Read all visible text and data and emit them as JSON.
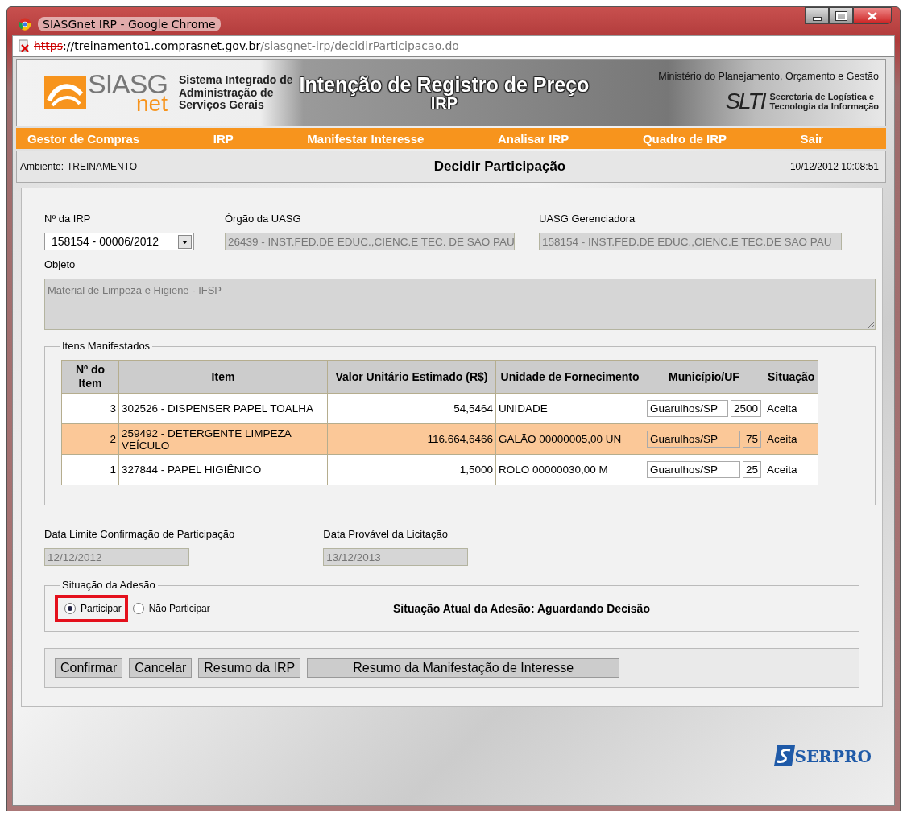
{
  "window": {
    "title": "SIASGnet IRP - Google Chrome"
  },
  "address_bar": {
    "scheme": "https",
    "insecure": true,
    "host": "://treinamento1.comprasnet.gov.br",
    "path": "/siasgnet-irp/decidirParticipacao.do"
  },
  "banner": {
    "logo": "SIASG",
    "logo_sub": "net",
    "system_name": [
      "Sistema Integrado de",
      "Administração de",
      "Serviços Gerais"
    ],
    "title": "Intenção de Registro de Preço",
    "title_sub": "IRP",
    "ministry": "Ministério do Planejamento, Orçamento e Gestão",
    "secretariat_logo": "SLTI",
    "secretariat": [
      "Secretaria de Logística e",
      "Tecnologia da Informação"
    ]
  },
  "menu": [
    "Gestor de Compras",
    "IRP",
    "Manifestar Interesse",
    "Analisar IRP",
    "Quadro de IRP",
    "Sair"
  ],
  "info_bar": {
    "environment_label": "Ambiente:",
    "environment": "TREINAMENTO",
    "heading": "Decidir Participação",
    "datetime": "10/12/2012 10:08:51"
  },
  "form": {
    "irp_label": "Nº da IRP",
    "irp_value": "158154 - 00006/2012",
    "orgao_label": "Órgão da UASG",
    "orgao_value": "26439 - INST.FED.DE EDUC.,CIENC.E TEC. DE SÃO PAU",
    "gerenciadora_label": "UASG Gerenciadora",
    "gerenciadora_value": "158154 - INST.FED.DE EDUC.,CIENC.E TEC.DE SÃO PAU",
    "objeto_label": "Objeto",
    "objeto_value": "Material de Limpeza e Higiene - IFSP"
  },
  "items": {
    "legend": "Itens Manifestados",
    "columns": [
      "Nº do Item",
      "Item",
      "Valor Unitário Estimado (R$)",
      "Unidade de Fornecimento",
      "Município/UF",
      "Situação"
    ],
    "rows": [
      {
        "number": "3",
        "item": "302526 - DISPENSER PAPEL TOALHA",
        "value": "54,5464",
        "unit": "UNIDADE",
        "city": "Guarulhos/SP",
        "quantity": "2500",
        "status": "Aceita",
        "highlighted": false
      },
      {
        "number": "2",
        "item": "259492 - DETERGENTE LIMPEZA VEÍCULO",
        "value": "116.664,6466",
        "unit": "GALÃO 00000005,00 UN",
        "city": "Guarulhos/SP",
        "quantity": "75",
        "status": "Aceita",
        "highlighted": true
      },
      {
        "number": "1",
        "item": "327844 - PAPEL HIGIÊNICO",
        "value": "1,5000",
        "unit": "ROLO 00000030,00 M",
        "city": "Guarulhos/SP",
        "quantity": "25",
        "status": "Aceita",
        "highlighted": false
      }
    ]
  },
  "dates": [
    {
      "label": "Data Limite Confirmação de Participação",
      "value": "12/12/2012"
    },
    {
      "label": "Data Provável da Licitação",
      "value": "13/12/2013"
    }
  ],
  "adhesion": {
    "legend": "Situação da Adesão",
    "options": [
      {
        "label": "Participar",
        "selected": true,
        "marked": true
      },
      {
        "label": "Não Participar",
        "selected": false,
        "marked": false
      }
    ],
    "current_status": "Situação Atual da Adesão: Aguardando Decisão"
  },
  "buttons": [
    "Confirmar",
    "Cancelar",
    "Resumo da IRP",
    "Resumo da Manifestação de Interesse"
  ],
  "footer": {
    "logo": "SERPRO"
  }
}
